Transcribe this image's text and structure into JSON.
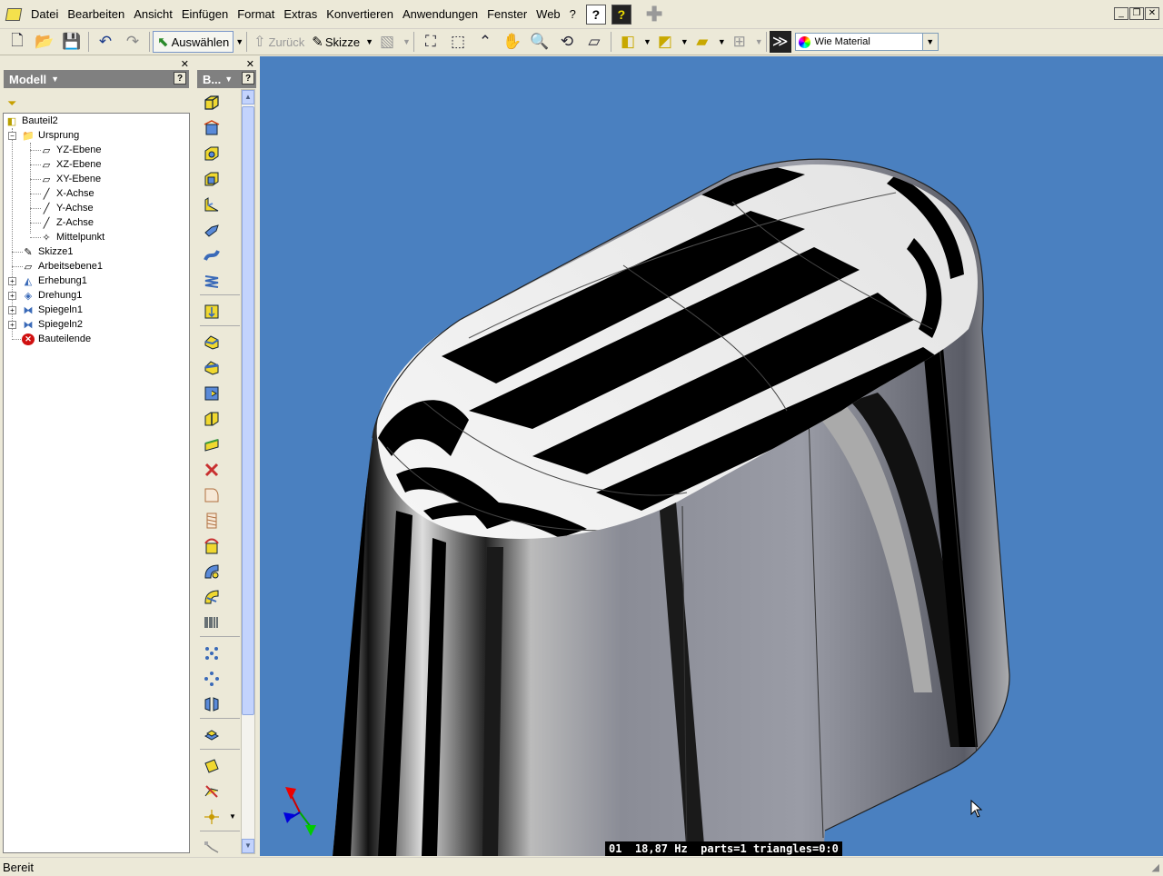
{
  "menubar": {
    "items": [
      "Datei",
      "Bearbeiten",
      "Ansicht",
      "Einfügen",
      "Format",
      "Extras",
      "Konvertieren",
      "Anwendungen",
      "Fenster",
      "Web",
      "?"
    ]
  },
  "toolbar": {
    "select_label": "Auswählen",
    "back_label": "Zurück",
    "sketch_label": "Skizze",
    "material_value": "Wie Material"
  },
  "model_panel": {
    "title": "Modell",
    "help": "?",
    "tree": {
      "root": "Bauteil2",
      "origin": "Ursprung",
      "yz_plane": "YZ-Ebene",
      "xz_plane": "XZ-Ebene",
      "xy_plane": "XY-Ebene",
      "x_axis": "X-Achse",
      "y_axis": "Y-Achse",
      "z_axis": "Z-Achse",
      "center_point": "Mittelpunkt",
      "sketch1": "Skizze1",
      "workplane1": "Arbeitsebene1",
      "loft1": "Erhebung1",
      "revolve1": "Drehung1",
      "mirror1": "Spiegeln1",
      "mirror2": "Spiegeln2",
      "part_end": "Bauteilende"
    }
  },
  "tools_panel": {
    "title": "B...",
    "help": "?"
  },
  "viewport": {
    "readout": "01  18,87 Hz  parts=1 triangles=0:0",
    "background": "#4a80c0"
  },
  "statusbar": {
    "text": "Bereit"
  }
}
